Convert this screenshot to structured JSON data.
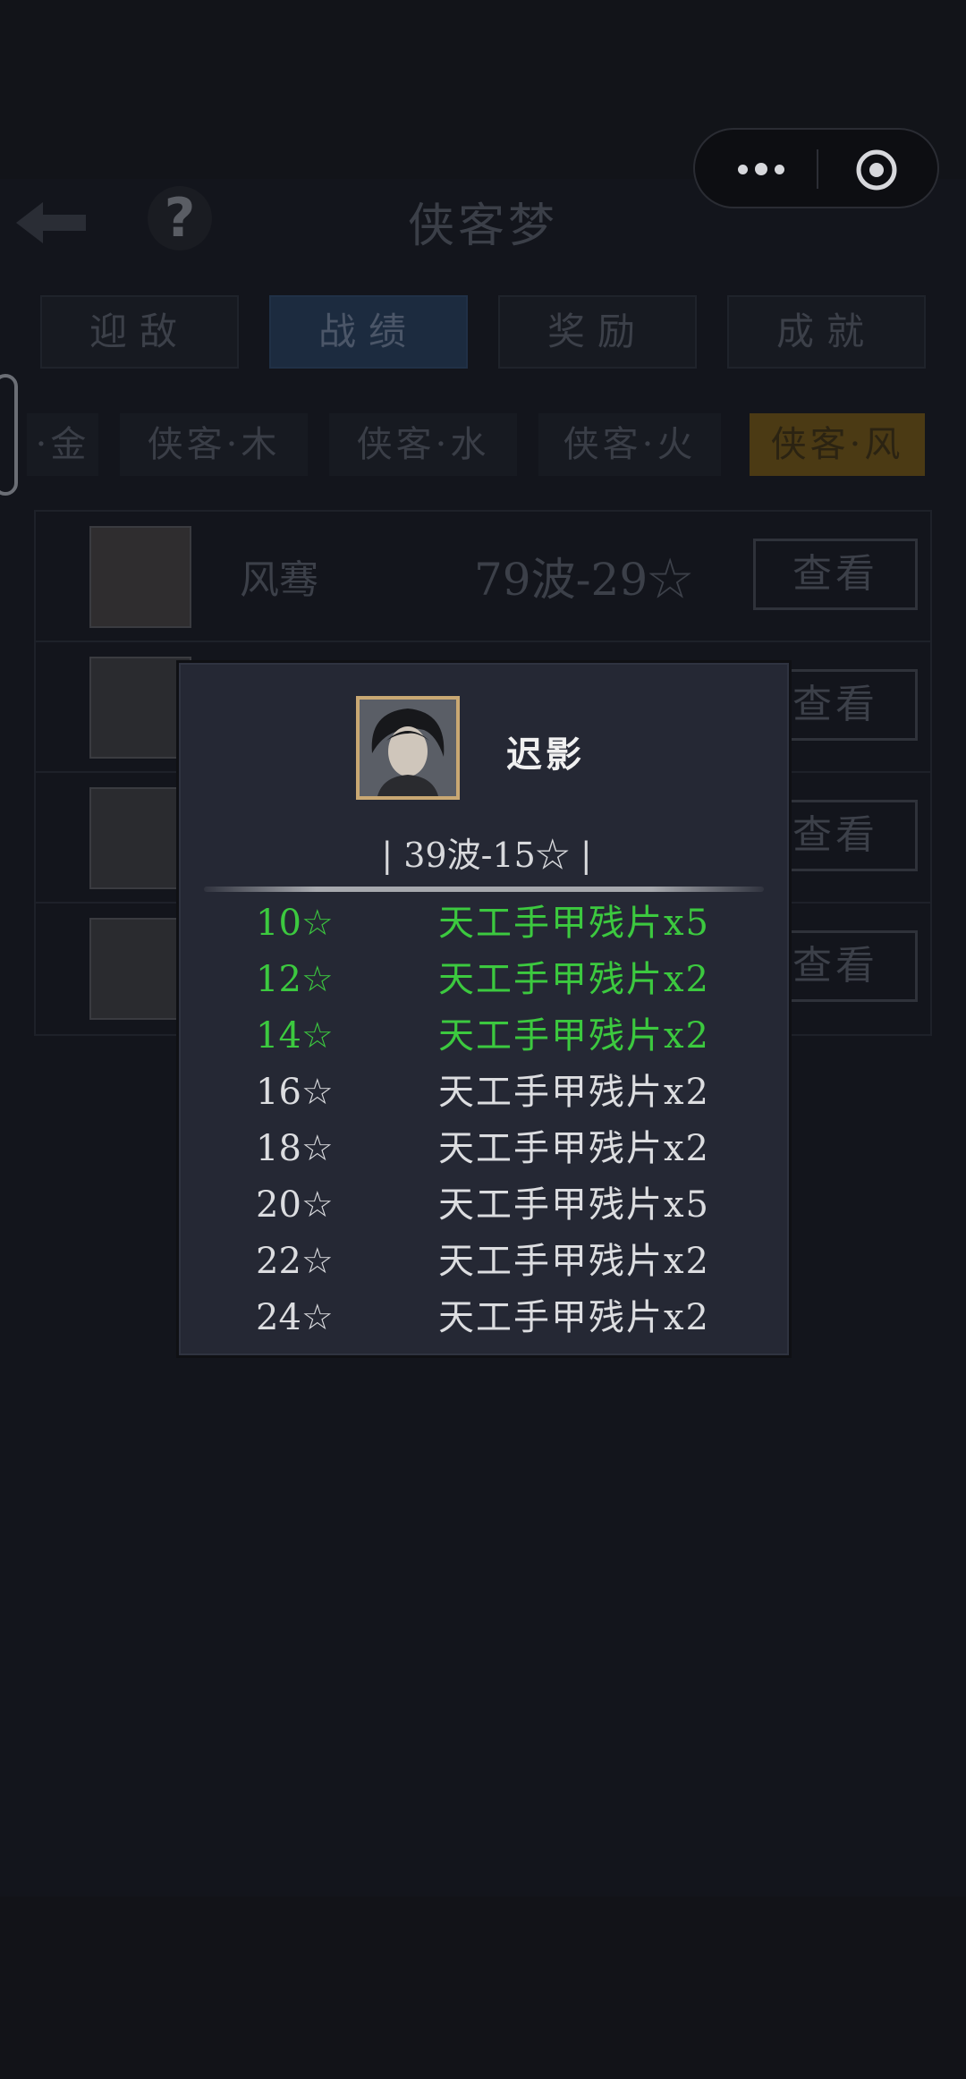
{
  "capsule": {
    "more_icon": "more-dots-icon",
    "close_icon": "target-circle-icon"
  },
  "header": {
    "title": "侠客梦",
    "help_glyph": "?"
  },
  "tabs": [
    {
      "label": "迎敌",
      "active": false
    },
    {
      "label": "战绩",
      "active": true
    },
    {
      "label": "奖励",
      "active": false
    },
    {
      "label": "成就",
      "active": false
    }
  ],
  "subtabs": [
    {
      "label": "·金",
      "active": false
    },
    {
      "label": "侠客·木",
      "active": false
    },
    {
      "label": "侠客·水",
      "active": false
    },
    {
      "label": "侠客·火",
      "active": false
    },
    {
      "label": "侠客·风",
      "active": true
    }
  ],
  "list": {
    "rows": [
      {
        "name": "风骞",
        "score": "79波-29☆",
        "button": "查看"
      },
      {
        "name": "",
        "score": "",
        "button": "查看"
      },
      {
        "name": "",
        "score": "",
        "button": "查看"
      },
      {
        "name": "",
        "score": "",
        "button": "查看"
      }
    ]
  },
  "modal": {
    "hero_name": "迟影",
    "record": "| 39波-15☆ |",
    "rewards": [
      {
        "stars": "10☆",
        "item": "天工手甲残片x5",
        "achieved": true
      },
      {
        "stars": "12☆",
        "item": "天工手甲残片x2",
        "achieved": true
      },
      {
        "stars": "14☆",
        "item": "天工手甲残片x2",
        "achieved": true
      },
      {
        "stars": "16☆",
        "item": "天工手甲残片x2",
        "achieved": false
      },
      {
        "stars": "18☆",
        "item": "天工手甲残片x2",
        "achieved": false
      },
      {
        "stars": "20☆",
        "item": "天工手甲残片x5",
        "achieved": false
      },
      {
        "stars": "22☆",
        "item": "天工手甲残片x2",
        "achieved": false
      },
      {
        "stars": "24☆",
        "item": "天工手甲残片x2",
        "achieved": false
      }
    ]
  },
  "colors": {
    "achieved": "#3cc93f",
    "pending": "#dcdde0",
    "active_subtab": "#4b3a14",
    "active_tab": "#1c2b3f"
  }
}
